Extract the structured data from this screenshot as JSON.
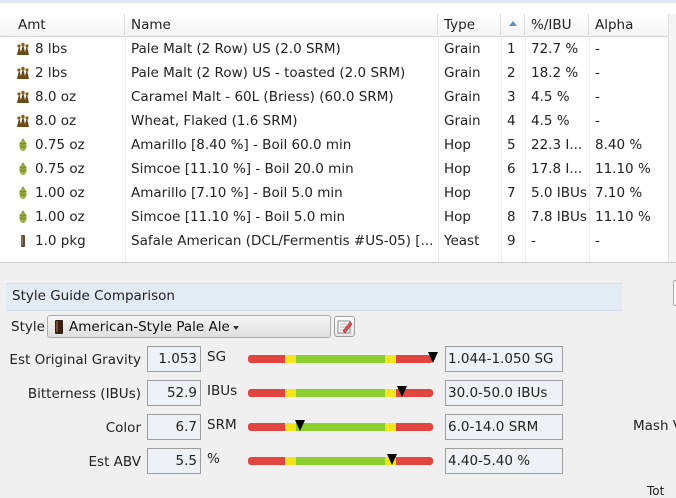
{
  "table": {
    "columns": [
      "Amt",
      "Name",
      "Type",
      "",
      "%/IBU",
      "Alpha"
    ],
    "rows": [
      {
        "amt": "8 lbs",
        "name": "Pale Malt (2 Row) US (2.0 SRM)",
        "type": "Grain",
        "num": "1",
        "pct": "72.7 %",
        "alpha": "-",
        "icon": "grain-icon"
      },
      {
        "amt": "2 lbs",
        "name": "Pale Malt (2 Row) US - toasted (2.0 SRM)",
        "type": "Grain",
        "num": "2",
        "pct": "18.2 %",
        "alpha": "-",
        "icon": "grain-icon"
      },
      {
        "amt": "8.0 oz",
        "name": "Caramel Malt - 60L (Briess) (60.0 SRM)",
        "type": "Grain",
        "num": "3",
        "pct": "4.5 %",
        "alpha": "-",
        "icon": "grain-icon"
      },
      {
        "amt": "8.0 oz",
        "name": "Wheat, Flaked (1.6 SRM)",
        "type": "Grain",
        "num": "4",
        "pct": "4.5 %",
        "alpha": "-",
        "icon": "grain-icon"
      },
      {
        "amt": "0.75 oz",
        "name": "Amarillo [8.40 %] - Boil 60.0 min",
        "type": "Hop",
        "num": "5",
        "pct": "22.3 I...",
        "alpha": "8.40 %",
        "icon": "hop-icon"
      },
      {
        "amt": "0.75 oz",
        "name": "Simcoe [11.10 %] - Boil 20.0 min",
        "type": "Hop",
        "num": "6",
        "pct": "17.8 I...",
        "alpha": "11.10 %",
        "icon": "hop-icon"
      },
      {
        "amt": "1.00 oz",
        "name": "Amarillo [7.10 %] - Boil 5.0 min",
        "type": "Hop",
        "num": "7",
        "pct": "5.0 IBUs",
        "alpha": "7.10 %",
        "icon": "hop-icon"
      },
      {
        "amt": "1.00 oz",
        "name": "Simcoe [11.10 %] - Boil 5.0 min",
        "type": "Hop",
        "num": "8",
        "pct": "7.8 IBUs",
        "alpha": "11.10 %",
        "icon": "hop-icon"
      },
      {
        "amt": "1.0 pkg",
        "name": "Safale American  (DCL/Fermentis #US-05) [...",
        "type": "Yeast",
        "num": "9",
        "pct": "-",
        "alpha": "-",
        "icon": "yeast-icon"
      }
    ]
  },
  "style_guide": {
    "title": "Style Guide Comparison",
    "style_label": "Style",
    "style_value": "American-Style Pale Ale",
    "metrics": [
      {
        "label": "Est Original Gravity",
        "value": "1.053",
        "unit": "SG",
        "range": "1.044-1.050 SG",
        "marker_fraction": 1.0
      },
      {
        "label": "Bitterness (IBUs)",
        "value": "52.9",
        "unit": "IBUs",
        "range": "30.0-50.0 IBUs",
        "marker_fraction": 0.83
      },
      {
        "label": "Color",
        "value": "6.7",
        "unit": "SRM",
        "range": "6.0-14.0 SRM",
        "marker_fraction": 0.28
      },
      {
        "label": "Est ABV",
        "value": "5.5",
        "unit": "%",
        "range": "4.40-5.40 %",
        "marker_fraction": 0.78
      }
    ],
    "mash_label_partial": "Mash V",
    "bottom_partial": "Tot"
  },
  "colors": {
    "meter_red": "#e0453f",
    "meter_yellow": "#f2e51d",
    "meter_green": "#8ccf2e",
    "header_band": "#e3ebf5"
  }
}
